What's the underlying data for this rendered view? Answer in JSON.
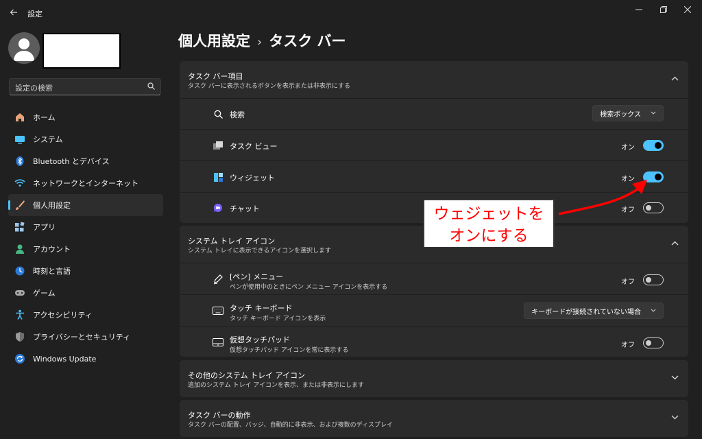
{
  "window": {
    "title": "設定"
  },
  "sidebar": {
    "search_placeholder": "設定の検索",
    "items": [
      {
        "label": "ホーム",
        "icon": "home-icon"
      },
      {
        "label": "システム",
        "icon": "system-icon"
      },
      {
        "label": "Bluetooth とデバイス",
        "icon": "bluetooth-icon"
      },
      {
        "label": "ネットワークとインターネット",
        "icon": "network-icon"
      },
      {
        "label": "個人用設定",
        "icon": "personalization-icon",
        "active": true
      },
      {
        "label": "アプリ",
        "icon": "apps-icon"
      },
      {
        "label": "アカウント",
        "icon": "account-icon"
      },
      {
        "label": "時刻と言語",
        "icon": "time-language-icon"
      },
      {
        "label": "ゲーム",
        "icon": "gaming-icon"
      },
      {
        "label": "アクセシビリティ",
        "icon": "accessibility-icon"
      },
      {
        "label": "プライバシーとセキュリティ",
        "icon": "privacy-icon"
      },
      {
        "label": "Windows Update",
        "icon": "windows-update-icon"
      }
    ]
  },
  "breadcrumb": {
    "parent": "個人用設定",
    "separator": "›",
    "current": "タスク バー"
  },
  "taskbar_items": {
    "title": "タスク バー項目",
    "subtitle": "タスク バーに表示されるボタンを表示または非表示にする",
    "rows": [
      {
        "label": "検索",
        "dropdown": "検索ボックス"
      },
      {
        "label": "タスク ビュー",
        "state": "オン",
        "on": true
      },
      {
        "label": "ウィジェット",
        "state": "オン",
        "on": true
      },
      {
        "label": "チャット",
        "state": "オフ",
        "on": false
      }
    ]
  },
  "system_tray": {
    "title": "システム トレイ アイコン",
    "subtitle": "システム トレイに表示できるアイコンを選択します",
    "rows": [
      {
        "label": "[ペン] メニュー",
        "sub": "ペンが使用中のときにペン メニュー アイコンを表示する",
        "state": "オフ",
        "on": false
      },
      {
        "label": "タッチ キーボード",
        "sub": "タッチ キーボード アイコンを表示",
        "dropdown": "キーボードが接続されていない場合"
      },
      {
        "label": "仮想タッチパッド",
        "sub": "仮想タッチパッド アイコンを常に表示する",
        "state": "オフ",
        "on": false
      }
    ]
  },
  "other_tray": {
    "title": "その他のシステム トレイ アイコン",
    "subtitle": "追加のシステム トレイ アイコンを表示、または非表示にします"
  },
  "behavior": {
    "title": "タスク バーの動作",
    "subtitle": "タスク バーの配置、バッジ、自動的に非表示、および複数のディスプレイ"
  },
  "annotation": {
    "line1": "ウェジェットを",
    "line2": "オンにする"
  },
  "colors": {
    "accent": "#4cc2ff",
    "annotation": "#ff0000",
    "background": "#202020",
    "card": "#2b2b2b"
  }
}
